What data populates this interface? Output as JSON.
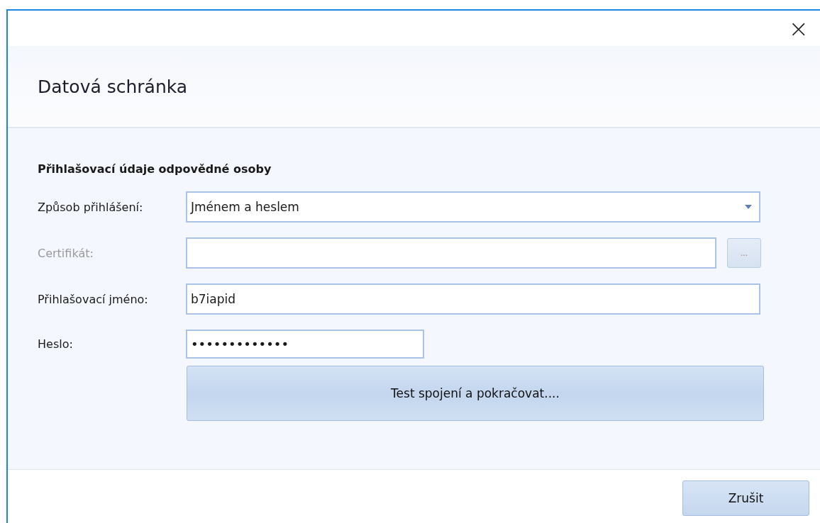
{
  "window": {
    "title": "Datová schránka",
    "close": "×"
  },
  "section_title": "Přihlašovací údaje odpovědné osoby",
  "fields": [
    {
      "kind": "dropdown",
      "label": "Způsob přihlášení:",
      "value": "Jménem a heslem",
      "disabled": false
    },
    {
      "kind": "browse",
      "label": "Certifikát:",
      "disabled": true,
      "button": "..."
    },
    {
      "kind": "text",
      "label": "Přihlašovací jméno:",
      "value": "b7iapid",
      "disabled": false
    },
    {
      "kind": "password",
      "label": "Heslo:",
      "value": "•••••••••••••",
      "disabled": false
    }
  ],
  "test_button": "Test spojení a pokračovat....",
  "cancel_button": "Zrušit"
}
